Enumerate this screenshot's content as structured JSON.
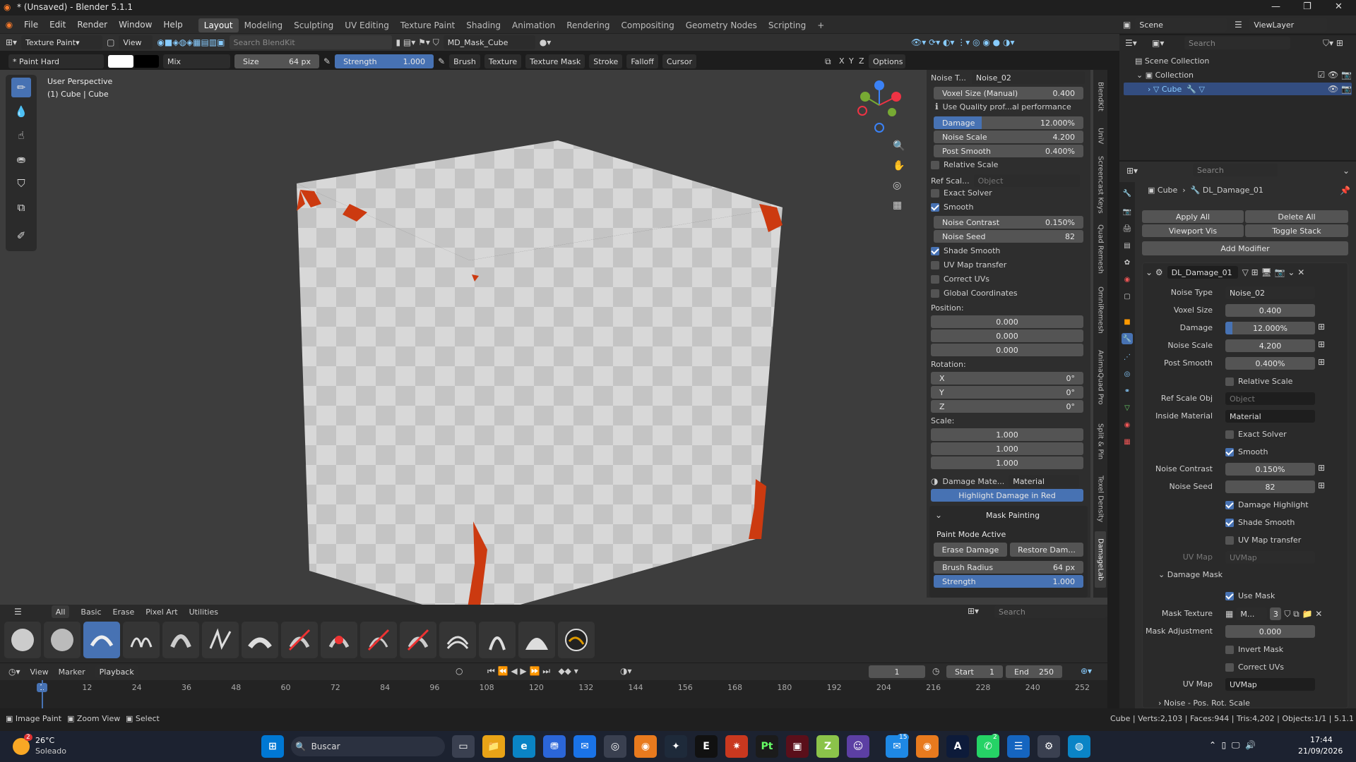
{
  "window": {
    "title": "* (Unsaved) - Blender 5.1.1"
  },
  "menu": [
    "File",
    "Edit",
    "Render",
    "Window",
    "Help"
  ],
  "workspaces": [
    "Layout",
    "Modeling",
    "Sculpting",
    "UV Editing",
    "Texture Paint",
    "Shading",
    "Animation",
    "Rendering",
    "Compositing",
    "Geometry Nodes",
    "Scripting",
    "+"
  ],
  "scene": {
    "scene_name": "Scene",
    "view_layer": "ViewLayer"
  },
  "header1": {
    "mode": "Texture Paint",
    "view": "View",
    "search_placeholder": "Search BlendKit",
    "mask_obj": "MD_Mask_Cube"
  },
  "header2": {
    "brush_name": "* Paint Hard",
    "blend": "Mix",
    "size_label": "Size",
    "size_value": "64 px",
    "strength_label": "Strength",
    "strength_value": "1.000",
    "menus": [
      "Brush",
      "Texture",
      "Texture Mask",
      "Stroke",
      "Falloff",
      "Cursor"
    ],
    "options": "Options",
    "axes": [
      "X",
      "Y",
      "Z"
    ]
  },
  "viewport": {
    "perspective": "User Perspective",
    "object": "(1) Cube | Cube"
  },
  "npanel": {
    "noise_type_label": "Noise T...",
    "noise_type": "Noise_02",
    "voxel_label": "Voxel Size (Manual)",
    "voxel_value": "0.400",
    "quality": "Use Quality prof...al performance",
    "damage_label": "Damage",
    "damage_value": "12.000%",
    "noise_scale_label": "Noise Scale",
    "noise_scale_value": "4.200",
    "post_smooth_label": "Post Smooth",
    "post_smooth_value": "0.400%",
    "relative_scale": "Relative Scale",
    "ref_scale_label": "Ref Scal...",
    "ref_scale_ph": "Object",
    "exact_solver": "Exact Solver",
    "smooth": "Smooth",
    "noise_contrast_label": "Noise Contrast",
    "noise_contrast_value": "0.150%",
    "noise_seed_label": "Noise Seed",
    "noise_seed_value": "82",
    "shade_smooth": "Shade Smooth",
    "uv_map_transfer": "UV Map transfer",
    "correct_uvs": "Correct UVs",
    "global_coords": "Global Coordinates",
    "position_label": "Position:",
    "position": [
      "0.000",
      "0.000",
      "0.000"
    ],
    "rotation_label": "Rotation:",
    "rotation": [
      [
        "X",
        "0°"
      ],
      [
        "Y",
        "0°"
      ],
      [
        "Z",
        "0°"
      ]
    ],
    "scale_label": "Scale:",
    "scale": [
      "1.000",
      "1.000",
      "1.000"
    ],
    "damage_mat_label": "Damage Mate...",
    "damage_mat": "Material",
    "highlight": "Highlight Damage in Red",
    "mask_painting": "Mask Painting",
    "paint_mode": "Paint Mode Active",
    "erase": "Erase Damage",
    "restore": "Restore Dam...",
    "brush_radius_label": "Brush Radius",
    "brush_radius_value": "64 px",
    "strength_label": "Strength",
    "strength_value": "1.000"
  },
  "vtabs": [
    "BlendKit",
    "UniV",
    "Screencast Keys",
    "Quad Remesh",
    "OmniRemesh",
    "AnimaQuad Pro",
    "Split & Pin",
    "Texel Density",
    "DamageLab"
  ],
  "shelf": {
    "tabs": [
      "All",
      "Basic",
      "Erase",
      "Pixel Art",
      "Utilities"
    ],
    "search": "Search"
  },
  "timeline": {
    "menus": [
      "View",
      "Marker",
      "Playback"
    ],
    "frame": "1",
    "start_label": "Start",
    "start": "1",
    "end_label": "End",
    "end": "250",
    "ticks": [
      "1",
      "12",
      "24",
      "36",
      "48",
      "60",
      "72",
      "84",
      "96",
      "108",
      "120",
      "132",
      "144",
      "156",
      "168",
      "180",
      "192",
      "204",
      "216",
      "228",
      "240",
      "252"
    ]
  },
  "status": {
    "left": [
      "Image Paint",
      "Zoom View",
      "Select"
    ],
    "right": "Cube | Verts:2,103 | Faces:944 | Tris:4,202 | Objects:1/1 | 5.1.1"
  },
  "outliner": {
    "search": "Search",
    "root": "Scene Collection",
    "collection": "Collection",
    "object": "Cube"
  },
  "properties": {
    "search": "Search",
    "breadcrumb_obj": "Cube",
    "breadcrumb_mod": "DL_Damage_01",
    "apply_all": "Apply All",
    "delete_all": "Delete All",
    "viewport_vis": "Viewport Vis",
    "toggle_stack": "Toggle Stack",
    "add_modifier": "Add Modifier",
    "modifier_name": "DL_Damage_01",
    "rows": [
      {
        "label": "Noise Type",
        "value": "Noise_02"
      },
      {
        "label": "Voxel Size",
        "value": "0.400"
      },
      {
        "label": "Damage",
        "value": "12.000%"
      },
      {
        "label": "Noise Scale",
        "value": "4.200"
      },
      {
        "label": "Post Smooth",
        "value": "0.400%"
      }
    ],
    "relative_scale": "Relative Scale",
    "ref_scale_label": "Ref Scale Obj",
    "ref_scale_ph": "Object",
    "inside_mat_label": "Inside Material",
    "inside_mat": "Material",
    "exact_solver": "Exact Solver",
    "smooth": "Smooth",
    "noise_contrast_label": "Noise Contrast",
    "noise_contrast": "0.150%",
    "noise_seed_label": "Noise Seed",
    "noise_seed": "82",
    "damage_highlight": "Damage Highlight",
    "shade_smooth": "Shade Smooth",
    "uv_map_transfer": "UV Map transfer",
    "uv_map_label": "UV Map",
    "uv_map_ph": "UVMap",
    "damage_mask": "Damage Mask",
    "use_mask": "Use Mask",
    "mask_texture_label": "Mask Texture",
    "mask_texture": "M...",
    "mask_users": "3",
    "mask_adj_label": "Mask Adjustment",
    "mask_adj": "0.000",
    "invert_mask": "Invert Mask",
    "correct_uvs": "Correct UVs",
    "uv_map2_label": "UV Map",
    "uv_map2": "UVMap",
    "noise_pos": "Noise - Pos. Rot. Scale"
  },
  "taskbar": {
    "temp": "26°C",
    "weather": "Soleado",
    "search": "Buscar",
    "time": "17:44",
    "date": "21/09/2026",
    "badge_weather": "2",
    "badge_outlook": "15",
    "badge_whatsapp": "2"
  },
  "colors": {
    "accent": "#4772b3",
    "damage": "#cc3a10",
    "bg": "#3d3d3d"
  }
}
